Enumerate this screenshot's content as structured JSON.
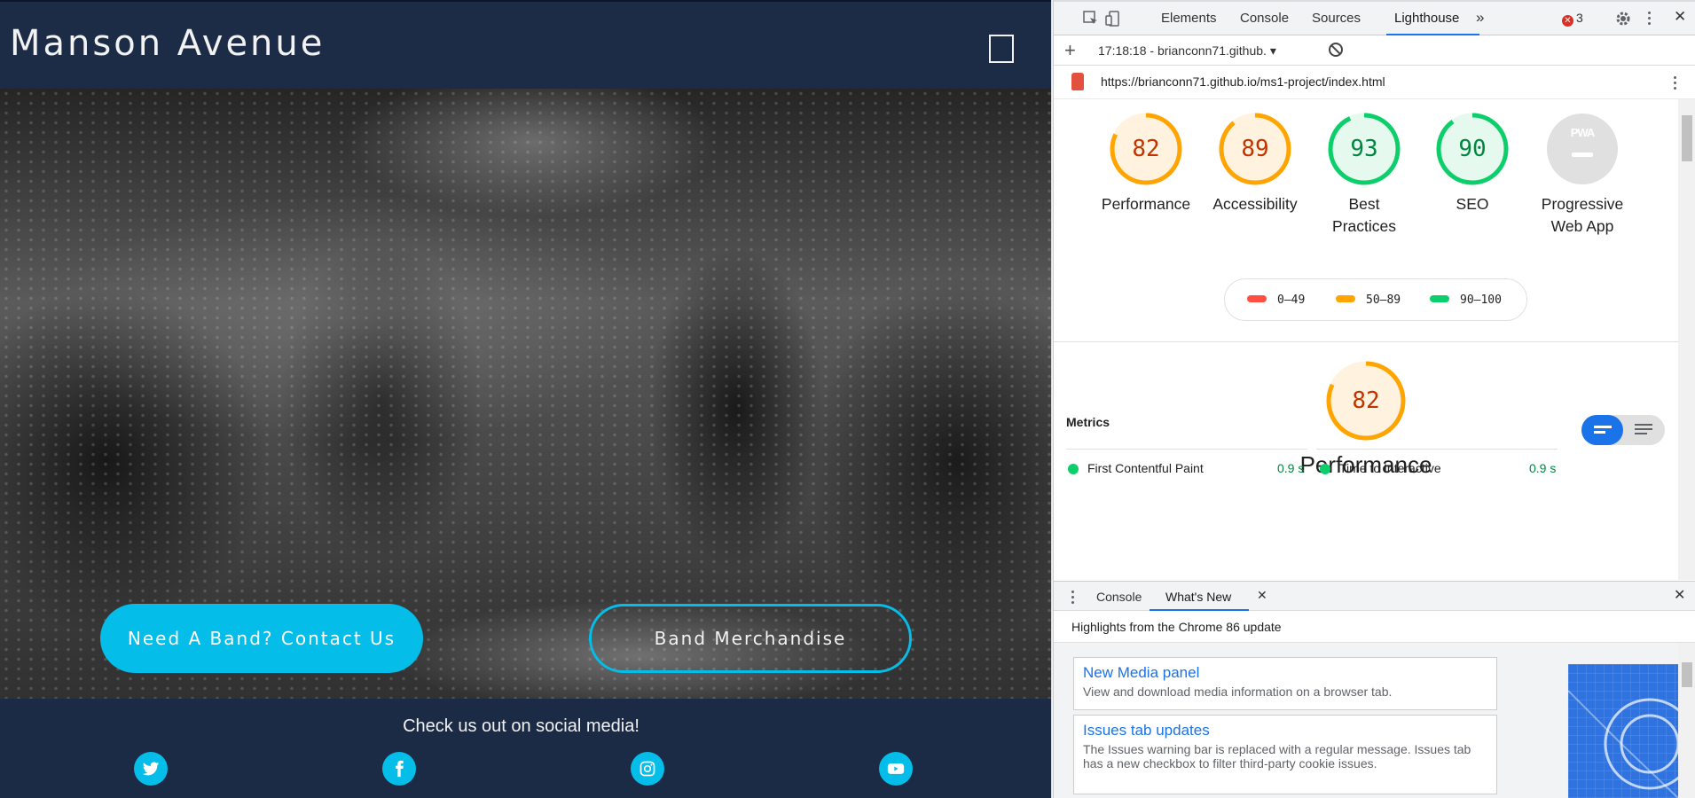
{
  "site": {
    "brand": "Manson Avenue",
    "hero_alt": "Band performing on stage in front of crowd",
    "contact_button": "Need A Band? Contact Us",
    "merch_button": "Band Merchandise",
    "social_title": "Check us out on social media!",
    "social_icons": [
      "twitter-icon",
      "facebook-icon",
      "instagram-icon",
      "youtube-icon"
    ],
    "accent_color": "#04bde8",
    "nav_color": "#1c2c46"
  },
  "devtools": {
    "tabs": [
      "Elements",
      "Console",
      "Sources",
      "Lighthouse"
    ],
    "active_tab": "Lighthouse",
    "more_tabs": "»",
    "error_count": "3",
    "report_label": "17:18:18 - brianconn71.github.",
    "url": "https://brianconn71.github.io/ms1-project/index.html",
    "gauges": [
      {
        "label": "Performance",
        "score": "82"
      },
      {
        "label": "Accessibility",
        "score": "89"
      },
      {
        "label": "Best\nPractices",
        "score": "93"
      },
      {
        "label": "SEO",
        "score": "90"
      },
      {
        "label": "Progressive\nWeb App",
        "score": ""
      }
    ],
    "pwa_badge": "PWA",
    "legend": [
      "0–49",
      "50–89",
      "90–100"
    ],
    "legend_colors": [
      "#ff4e42",
      "#ffa400",
      "#0cce6b"
    ],
    "main_score": "82",
    "main_label": "Performance",
    "metrics_title": "Metrics",
    "metrics": [
      {
        "name": "First Contentful Paint",
        "value": "0.9 s"
      },
      {
        "name": "Time to Interactive",
        "value": "0.9 s"
      }
    ],
    "drawer_tabs": [
      "Console",
      "What's New"
    ],
    "highlights": "Highlights from the Chrome 86 update",
    "whats_new": [
      {
        "title": "New Media panel",
        "desc": "View and download media information on a browser tab."
      },
      {
        "title": "Issues tab updates",
        "desc": "The Issues warning bar is replaced with a regular message. Issues tab has a new checkbox to filter third-party cookie issues."
      }
    ]
  }
}
